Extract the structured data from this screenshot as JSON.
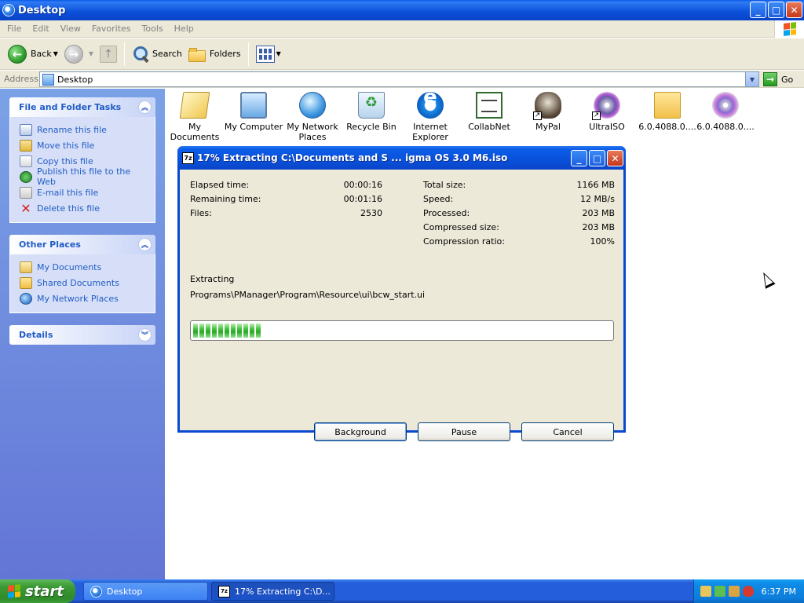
{
  "window": {
    "title": "Desktop",
    "buttons": {
      "minimize": "_",
      "maximize": "□",
      "close": "✕"
    }
  },
  "menu": [
    "File",
    "Edit",
    "View",
    "Favorites",
    "Tools",
    "Help"
  ],
  "toolbar": {
    "back_label": "Back",
    "search_label": "Search",
    "folders_label": "Folders"
  },
  "address": {
    "label": "Address",
    "value": "Desktop",
    "go_label": "Go"
  },
  "taskpane": {
    "file_tasks": {
      "title": "File and Folder Tasks",
      "items": [
        {
          "label": "Rename this file",
          "icon": "rename-icon"
        },
        {
          "label": "Move this file",
          "icon": "move-icon"
        },
        {
          "label": "Copy this file",
          "icon": "copy-icon"
        },
        {
          "label": "Publish this file to the Web",
          "icon": "publish-icon"
        },
        {
          "label": "E-mail this file",
          "icon": "email-icon"
        },
        {
          "label": "Delete this file",
          "icon": "delete-icon"
        }
      ]
    },
    "other_places": {
      "title": "Other Places",
      "items": [
        {
          "label": "My Documents",
          "icon": "my-documents-icon"
        },
        {
          "label": "Shared Documents",
          "icon": "shared-documents-icon"
        },
        {
          "label": "My Network Places",
          "icon": "network-places-icon"
        }
      ]
    },
    "details": {
      "title": "Details"
    }
  },
  "desktop_icons": [
    {
      "label": "My Documents",
      "icon": "my-documents-icon"
    },
    {
      "label": "My Computer",
      "icon": "my-computer-icon"
    },
    {
      "label": "My Network Places",
      "icon": "network-places-icon"
    },
    {
      "label": "Recycle Bin",
      "icon": "recycle-bin-icon"
    },
    {
      "label": "Internet Explorer",
      "icon": "internet-explorer-icon"
    },
    {
      "label": "CollabNet",
      "icon": "collabnet-icon"
    },
    {
      "label": "MyPal",
      "icon": "mypal-icon"
    },
    {
      "label": "UltraISO",
      "icon": "ultraiso-icon"
    },
    {
      "label": "6.0.4088.0....",
      "icon": "folder-icon"
    },
    {
      "label": "6.0.4088.0....",
      "icon": "disc-image-icon"
    }
  ],
  "dialog": {
    "title": "17% Extracting C:\\Documents and S ... igma OS 3.0 M6.iso",
    "app_icon_text": "7z",
    "stats_left": [
      {
        "label": "Elapsed time:",
        "value": "00:00:16"
      },
      {
        "label": "Remaining time:",
        "value": "00:01:16"
      },
      {
        "label": "Files:",
        "value": "2530"
      }
    ],
    "stats_right": [
      {
        "label": "Total size:",
        "value": "1166 MB"
      },
      {
        "label": "Speed:",
        "value": "12 MB/s"
      },
      {
        "label": "Processed:",
        "value": "203 MB"
      },
      {
        "label": "Compressed size:",
        "value": "203 MB"
      },
      {
        "label": "Compression ratio:",
        "value": "100%"
      }
    ],
    "extracting_label": "Extracting",
    "current_path": "Programs\\PManager\\Program\\Resource\\ui\\bcw_start.ui",
    "progress_fraction": 0.17,
    "buttons": {
      "background": "Background",
      "pause": "Pause",
      "cancel": "Cancel"
    }
  },
  "taskbar": {
    "start_label": "start",
    "tasks": [
      {
        "label": "Desktop",
        "active": false
      },
      {
        "label": "17% Extracting C:\\D...",
        "active": true
      }
    ],
    "clock": "6:37 PM"
  },
  "colors": {
    "xp_blue": "#0a48d0",
    "taskpane_link": "#215dc6",
    "progress_green": "#2aa827",
    "start_green": "#3c9a36"
  }
}
